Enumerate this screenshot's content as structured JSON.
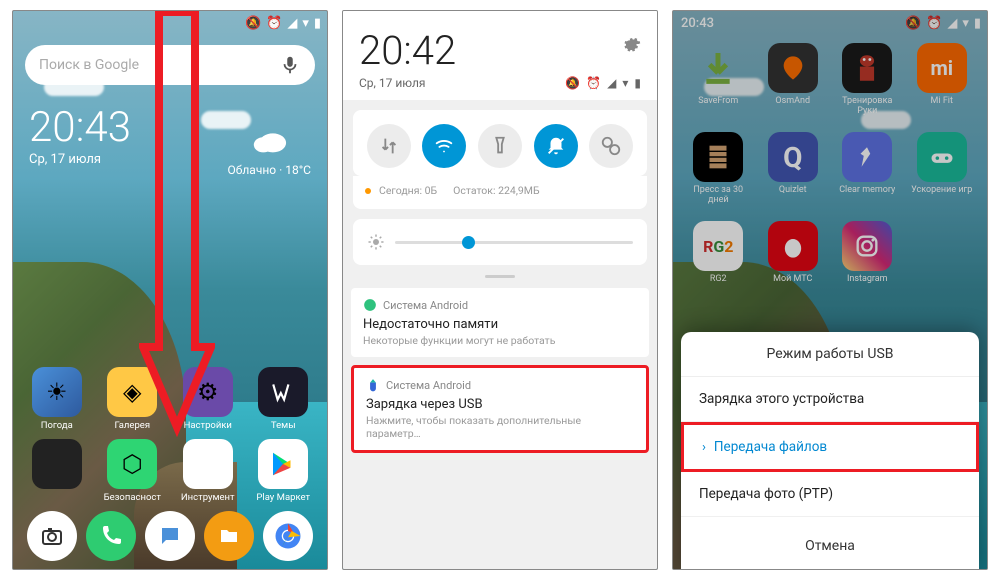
{
  "status": {
    "time": "20:43",
    "silent": "🔕",
    "alarm": "⏰",
    "signal": "📶",
    "wifi": "📶",
    "battery": "▮"
  },
  "p1": {
    "search_placeholder": "Поиск в Google",
    "clock": "20:43",
    "date": "Ср, 17 июля",
    "weather_label": "Облачно · 18°С",
    "apps_row1": [
      {
        "name": "Погода",
        "key": "weather"
      },
      {
        "name": "Галерея",
        "key": "gallery"
      },
      {
        "name": "Настройки",
        "key": "settings"
      },
      {
        "name": "Темы",
        "key": "themes"
      }
    ],
    "apps_row2": [
      {
        "name": "",
        "key": "multi"
      },
      {
        "name": "Безопасност",
        "key": "security"
      },
      {
        "name": "Инструмент",
        "key": "tools"
      },
      {
        "name": "Play Маркет",
        "key": "play"
      }
    ],
    "dock": [
      {
        "key": "camera"
      },
      {
        "key": "phone"
      },
      {
        "key": "sms"
      },
      {
        "key": "files"
      },
      {
        "key": "browser"
      }
    ]
  },
  "p2": {
    "bigtime": "20:42",
    "date": "Ср, 17 июля",
    "data_today": "Сегодня: 0Б",
    "data_remaining": "Остаток: 224,9МБ",
    "notif1": {
      "src": "Система Android",
      "title": "Недостаточно памяти",
      "body": "Некоторые функции могут не работать"
    },
    "notif2": {
      "src": "Система Android",
      "title": "Зарядка через USB",
      "body": "Нажмите, чтобы показать дополнительные параметр…"
    }
  },
  "p3": {
    "apps_r1": [
      {
        "name": "SaveFrom",
        "key": "savefrom"
      },
      {
        "name": "OsmAnd",
        "key": "osmand"
      },
      {
        "name": "Тренировка Руки",
        "key": "train"
      },
      {
        "name": "Mi Fit",
        "key": "mifit"
      }
    ],
    "apps_r2": [
      {
        "name": "Пресс за 30 дней",
        "key": "press"
      },
      {
        "name": "Quizlet",
        "key": "quizlet"
      },
      {
        "name": "Clear memory",
        "key": "clear"
      },
      {
        "name": "Ускорение игр",
        "key": "boost"
      }
    ],
    "apps_r3": [
      {
        "name": "RG2",
        "key": "rg2"
      },
      {
        "name": "Мой МТС",
        "key": "mts"
      },
      {
        "name": "Instagram",
        "key": "insta"
      }
    ],
    "sheet": {
      "title": "Режим работы USB",
      "opt1": "Зарядка этого устройства",
      "opt2": "Передача файлов",
      "opt3": "Передача фото (PTP)",
      "cancel": "Отмена"
    }
  }
}
